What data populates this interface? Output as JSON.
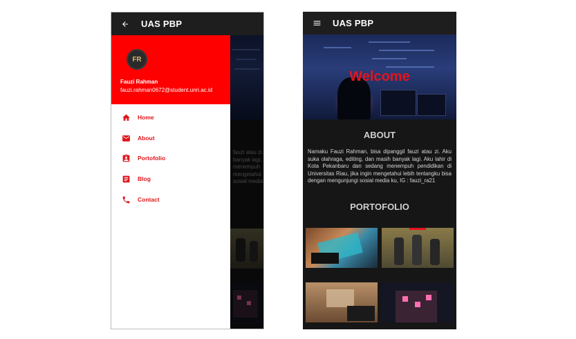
{
  "app": {
    "title": "UAS PBP"
  },
  "drawer": {
    "user_name": "Fauzi Rahman",
    "user_email": "fauzi.rahman0672@student.unri.ac.id",
    "avatar_initials": "FR",
    "items": [
      {
        "label": "Home",
        "icon": "home-icon"
      },
      {
        "label": "About",
        "icon": "mail-icon"
      },
      {
        "label": "Portofolio",
        "icon": "badge-icon"
      },
      {
        "label": "Blog",
        "icon": "article-icon"
      },
      {
        "label": "Contact",
        "icon": "phone-icon"
      }
    ]
  },
  "home": {
    "welcome": "Welcome",
    "about_title": "ABOUT",
    "about_text": "Namaku Fauzi Rahman, bisa dipanggil fauzi atau zi. Aku suka olahraga, editing, dan masih banyak lagi. Aku lahir di Kota Pekanbaru dan sedang menempuh pendidikan di Universitas Riau, jika ingin mengetahui lebih tentangku bisa dengan mengunjungi sosial media ku, IG : fauzi_ra21",
    "portfolio_title": "PORTOFOLIO"
  },
  "colors": {
    "accent": "#ff0000",
    "appbar": "#1e1e1e",
    "background": "#161616"
  }
}
